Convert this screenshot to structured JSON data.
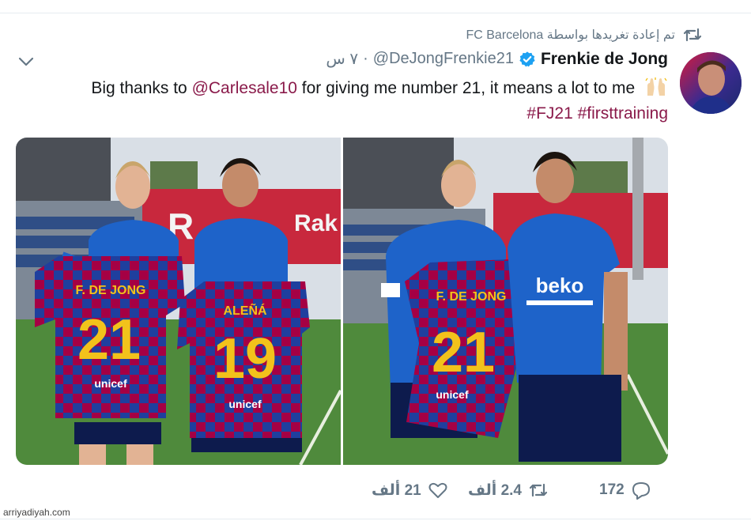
{
  "retweet": {
    "text": "تم إعادة تغريدها بواسطة FC Barcelona",
    "icon": "retweet-icon"
  },
  "author": {
    "name": "Frenkie de Jong",
    "handle": "@DeJongFrenkie21",
    "time": "٧ س",
    "separator": "·",
    "verified_icon": "verified-badge-icon"
  },
  "tweet": {
    "line1_prefix": "Big thanks to ",
    "mention": "@Carlesale10",
    "line1_suffix": " for giving me number 21, it means a lot to me",
    "emoji": "raising-hands-icon",
    "hashtag1": "#FJ21",
    "hashtag2": "#firsttraining"
  },
  "media": {
    "photos": [
      {
        "jersey_left_name": "F. DE JONG",
        "jersey_left_number": "21",
        "jersey_right_name": "ALEÑÁ",
        "jersey_right_number": "19",
        "sponsor": "unicef",
        "sign_letter": "R",
        "sign_text": "Rak"
      },
      {
        "jersey_name": "F. DE JONG",
        "jersey_number": "21",
        "sponsor": "unicef",
        "shirt_sponsor": "beko"
      }
    ]
  },
  "actions": {
    "replies": "172",
    "retweets": "2.4 ألف",
    "likes": "21 ألف"
  },
  "watermark": "arriyadiyah.com",
  "colors": {
    "link": "#8a1a4a",
    "secondary": "#657786",
    "verified": "#1da1f2",
    "blaugrana_blue": "#1f3f9e",
    "blaugrana_red": "#a50044",
    "gold": "#f2c21b"
  }
}
